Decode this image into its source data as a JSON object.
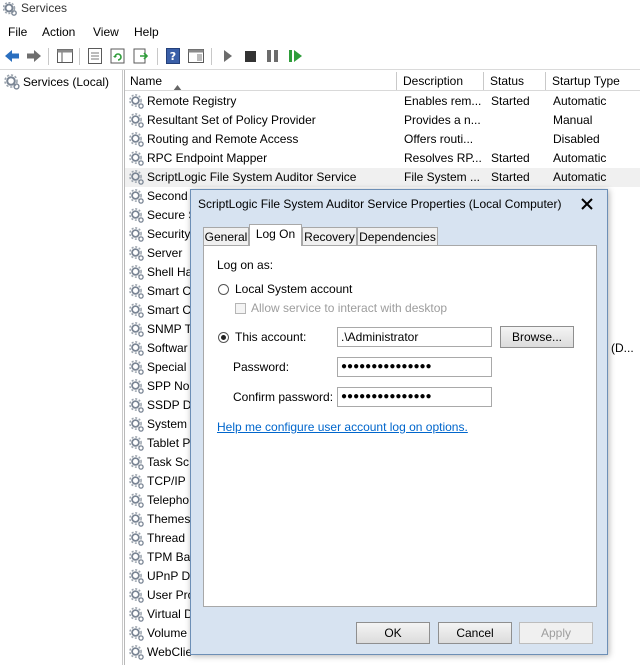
{
  "window": {
    "title": "Services"
  },
  "menu": {
    "file": "File",
    "action": "Action",
    "view": "View",
    "help": "Help"
  },
  "tree": {
    "root": "Services (Local)"
  },
  "columns": {
    "name": "Name",
    "description": "Description",
    "status": "Status",
    "startup": "Startup Type"
  },
  "services": [
    {
      "name": "Remote Registry",
      "description": "Enables rem...",
      "status": "Started",
      "startup": "Automatic"
    },
    {
      "name": "Resultant Set of Policy Provider",
      "description": "Provides a n...",
      "status": "",
      "startup": "Manual"
    },
    {
      "name": "Routing and Remote Access",
      "description": "Offers routi...",
      "status": "",
      "startup": "Disabled"
    },
    {
      "name": "RPC Endpoint Mapper",
      "description": "Resolves RP...",
      "status": "Started",
      "startup": "Automatic"
    },
    {
      "name": "ScriptLogic File System Auditor Service",
      "description": "File System ...",
      "status": "Started",
      "startup": "Automatic"
    },
    {
      "name": "Second",
      "description": "",
      "status": "",
      "startup": ""
    },
    {
      "name": "Secure S",
      "description": "",
      "status": "",
      "startup": ""
    },
    {
      "name": "Security",
      "description": "",
      "status": "",
      "startup": ""
    },
    {
      "name": "Server",
      "description": "",
      "status": "",
      "startup": ""
    },
    {
      "name": "Shell Ha",
      "description": "",
      "status": "",
      "startup": ""
    },
    {
      "name": "Smart C",
      "description": "",
      "status": "",
      "startup": ""
    },
    {
      "name": "Smart C",
      "description": "",
      "status": "",
      "startup": ""
    },
    {
      "name": "SNMP T",
      "description": "",
      "status": "",
      "startup": ""
    },
    {
      "name": "Softwar",
      "description": "",
      "status": "",
      "startup": "(D..."
    },
    {
      "name": "Special",
      "description": "",
      "status": "",
      "startup": ""
    },
    {
      "name": "SPP No",
      "description": "",
      "status": "",
      "startup": ""
    },
    {
      "name": "SSDP Di",
      "description": "",
      "status": "",
      "startup": ""
    },
    {
      "name": "System",
      "description": "",
      "status": "",
      "startup": ""
    },
    {
      "name": "Tablet P",
      "description": "",
      "status": "",
      "startup": ""
    },
    {
      "name": "Task Sc",
      "description": "",
      "status": "",
      "startup": ""
    },
    {
      "name": "TCP/IP",
      "description": "",
      "status": "",
      "startup": ""
    },
    {
      "name": "Telepho",
      "description": "",
      "status": "",
      "startup": ""
    },
    {
      "name": "Themes",
      "description": "",
      "status": "",
      "startup": ""
    },
    {
      "name": "Thread",
      "description": "",
      "status": "",
      "startup": ""
    },
    {
      "name": "TPM Ba",
      "description": "",
      "status": "",
      "startup": ""
    },
    {
      "name": "UPnP D",
      "description": "",
      "status": "",
      "startup": ""
    },
    {
      "name": "User Pro",
      "description": "",
      "status": "",
      "startup": ""
    },
    {
      "name": "Virtual D",
      "description": "",
      "status": "",
      "startup": ""
    },
    {
      "name": "Volume",
      "description": "",
      "status": "",
      "startup": ""
    },
    {
      "name": "WebClie",
      "description": "",
      "status": "",
      "startup": ""
    }
  ],
  "dialog": {
    "title": "ScriptLogic File System Auditor Service Properties (Local Computer)",
    "tabs": {
      "general": "General",
      "logon": "Log On",
      "recovery": "Recovery",
      "dependencies": "Dependencies"
    },
    "logon_as": "Log on as:",
    "local_system": "Local System account",
    "allow_interact": "Allow service to interact with desktop",
    "this_account": "This account:",
    "account_value": ".\\Administrator",
    "browse": "Browse...",
    "password_label": "Password:",
    "password_value": "●●●●●●●●●●●●●●●",
    "confirm_label": "Confirm password:",
    "confirm_value": "●●●●●●●●●●●●●●●",
    "help_link": "Help me configure user account log on options.",
    "ok": "OK",
    "cancel": "Cancel",
    "apply": "Apply",
    "selected_option": "this_account"
  },
  "colors": {
    "accent": "#d7e3f1",
    "link": "#0066cc",
    "toolbar_blue": "#2b6fbf",
    "toolbar_green": "#2f9d3a"
  }
}
